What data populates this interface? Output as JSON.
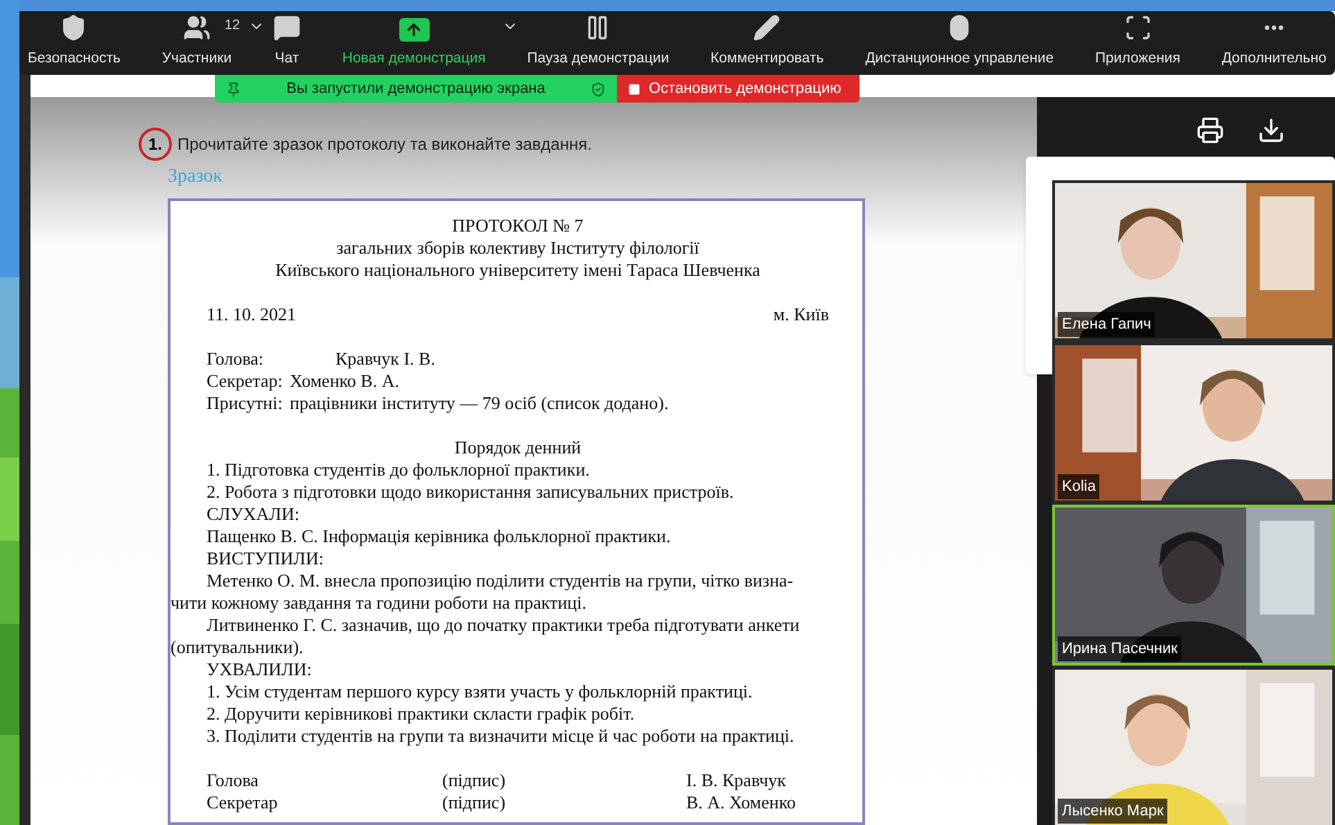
{
  "toolbar": [
    {
      "kind": "security",
      "label": "Безопасность",
      "highlighted": false
    },
    {
      "kind": "participants",
      "label": "Участники",
      "badge": "12",
      "caret": true,
      "highlighted": false
    },
    {
      "kind": "chat",
      "label": "Чат",
      "highlighted": false
    },
    {
      "kind": "share",
      "label": "Новая демонстрация",
      "caret": true,
      "highlighted": true
    },
    {
      "kind": "pause",
      "label": "Пауза демонстрации",
      "highlighted": false
    },
    {
      "kind": "annotate",
      "label": "Комментировать",
      "highlighted": false
    },
    {
      "kind": "remote",
      "label": "Дистанционное управление",
      "highlighted": false
    },
    {
      "kind": "apps",
      "label": "Приложения",
      "highlighted": false
    },
    {
      "kind": "more",
      "label": "Дополнительно",
      "highlighted": false
    }
  ],
  "share_banner": {
    "message": "Вы запустили демонстрацию экрана",
    "stop_button": "Остановить демонстрацию"
  },
  "document": {
    "task_number": "1.",
    "task_text": "Прочитайте зразок протоколу та виконайте завдання.",
    "sample_label": "Зразок",
    "protocol": {
      "title": "ПРОТОКОЛ № 7",
      "subtitle": [
        "загальних зборів колективу Інституту філології",
        "Київського національного університету імені Тараса Шевченка"
      ],
      "date": "11. 10. 2021",
      "place": "м. Київ",
      "attendance": [
        {
          "label": "Голова:",
          "value": "Кравчук І. В."
        },
        {
          "label": "Секретар:",
          "value": "Хоменко В. А."
        },
        {
          "label": "Присутні:",
          "value": "працівники інституту — 79 осіб (список додано)."
        }
      ],
      "agenda_title": "Порядок денний",
      "lines": [
        {
          "kind": "indent",
          "text": "1. Підготовка студентів до фольклорної практики."
        },
        {
          "kind": "indent",
          "text": "2. Робота з підготовки щодо використання записувальних пристроїв."
        },
        {
          "kind": "indent",
          "text": "СЛУХАЛИ:"
        },
        {
          "kind": "indent",
          "text": "Пащенко В. С. Інформація керівника фольклорної практики."
        },
        {
          "kind": "indent",
          "text": "ВИСТУПИЛИ:"
        },
        {
          "kind": "indent",
          "text": "Метенко О. М. внесла пропозицію поділити студентів на групи, чітко визна-"
        },
        {
          "kind": "plain",
          "text": "чити кожному завдання та години роботи на практиці."
        },
        {
          "kind": "indent",
          "text": "Литвиненко Г. С. зазначив, що до початку практики треба підготувати анкети"
        },
        {
          "kind": "plain",
          "text": "(опитувальники)."
        },
        {
          "kind": "indent",
          "text": "УХВАЛИЛИ:"
        },
        {
          "kind": "indent",
          "text": "1. Усім студентам першого курсу взяти участь у фольклорній практиці."
        },
        {
          "kind": "indent",
          "text": "2. Доручити керівникові практики скласти графік робіт."
        },
        {
          "kind": "indent",
          "text": "3. Поділити студентів на групи та визначити місце й час роботи на практиці."
        }
      ],
      "signatures": [
        {
          "role": "Голова",
          "sign": "(підпис)",
          "name": "І. В. Кравчук"
        },
        {
          "role": "Секретар",
          "sign": "(підпис)",
          "name": "В. А. Хоменко"
        }
      ]
    }
  },
  "videos": [
    {
      "name": "Елена Гапич",
      "highlighted": false
    },
    {
      "name": "Kolia",
      "highlighted": false
    },
    {
      "name": "Ирина Пасечник",
      "highlighted": true
    },
    {
      "name": "Лысенко Марк",
      "highlighted": false
    }
  ]
}
